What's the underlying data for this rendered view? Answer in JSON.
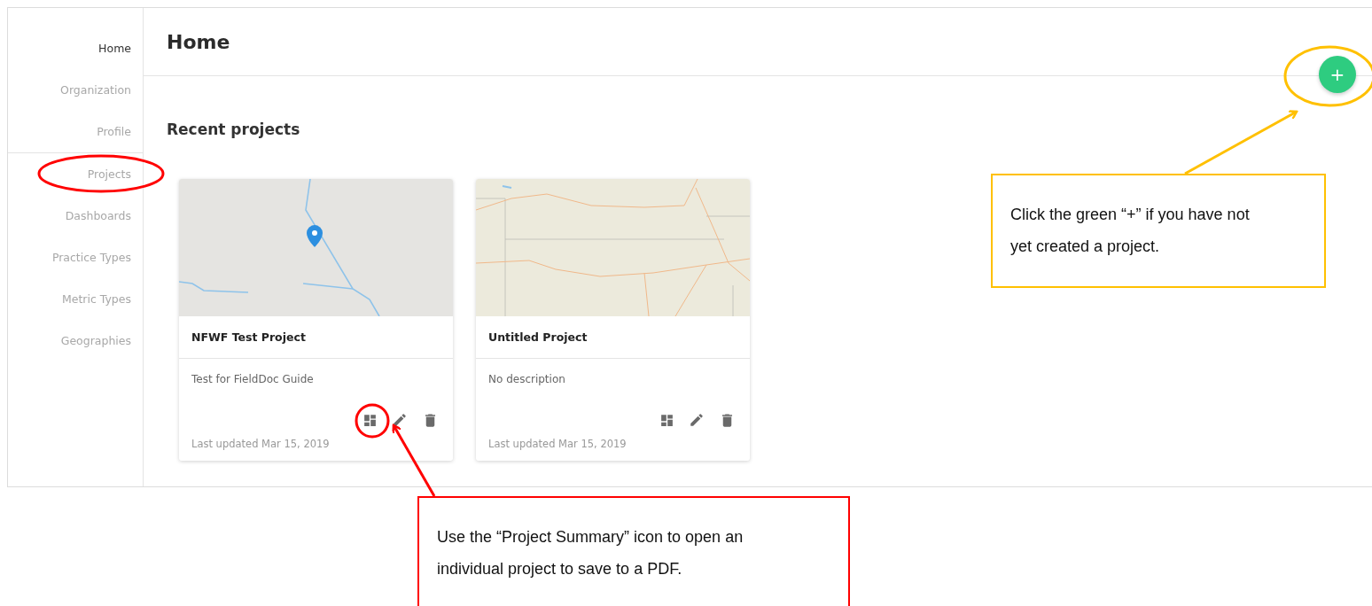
{
  "sidebar": {
    "groups": [
      [
        {
          "label": "Home",
          "selected": true
        },
        {
          "label": "Organization",
          "selected": false
        },
        {
          "label": "Profile",
          "selected": false
        }
      ],
      [
        {
          "label": "Projects",
          "selected": false
        },
        {
          "label": "Dashboards",
          "selected": false
        },
        {
          "label": "Practice Types",
          "selected": false
        },
        {
          "label": "Metric Types",
          "selected": false
        },
        {
          "label": "Geographies",
          "selected": false
        }
      ]
    ]
  },
  "page": {
    "title": "Home",
    "add_button": "+"
  },
  "section_title": "Recent projects",
  "projects": [
    {
      "name": "NFWF Test Project",
      "description": "Test for FieldDoc Guide",
      "updated": "Last updated Mar 15, 2019",
      "kind": "pin"
    },
    {
      "name": "Untitled Project",
      "description": "No description",
      "updated": "Last updated Mar 15, 2019",
      "kind": "region"
    }
  ],
  "callouts": [
    {
      "text": "Click the green “+” if you have not yet created a project.",
      "color": "#ffc000"
    },
    {
      "text": "Use the “Project Summary” icon to open an individual project to save to a PDF.",
      "color": "#ff0000"
    }
  ]
}
